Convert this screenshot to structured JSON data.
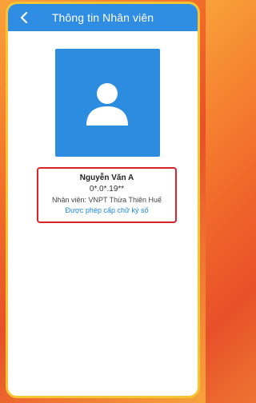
{
  "header": {
    "title": "Thông tin Nhân viên",
    "back_icon": "chevron-left-icon"
  },
  "profile": {
    "avatar_icon": "user-icon",
    "name": "Nguyễn Văn A",
    "ip": "0*.0*.19**",
    "unit": "Nhân viên: VNPT Thừa Thiên Huế",
    "permission": "Được phép cấp chữ ký số"
  },
  "colors": {
    "header": "#2f8de4",
    "avatar_bg": "#2c8de0",
    "highlight_border": "#d8232a",
    "link": "#1a86d8",
    "frame_border": "#f7c531"
  }
}
